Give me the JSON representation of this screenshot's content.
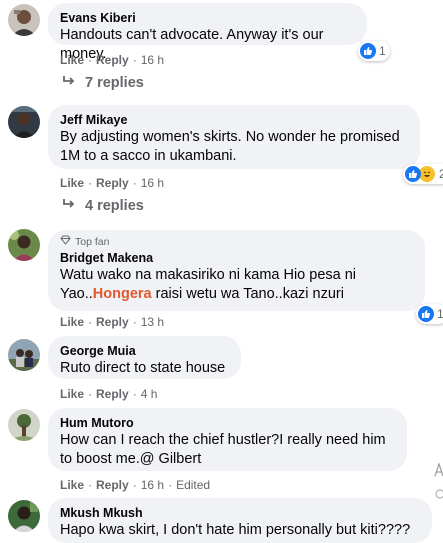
{
  "comments": [
    {
      "author": "Evans Kiberi",
      "text": "Handouts can't advocate. Anyway it's our money.",
      "like_label": "Like",
      "reply_label": "Reply",
      "time": "16 h",
      "reaction_count": "1",
      "replies_label": "7 replies"
    },
    {
      "author": "Jeff Mikaye",
      "text": "By adjusting women's skirts. No wonder he promised 1M to a sacco in ukambani.",
      "like_label": "Like",
      "reply_label": "Reply",
      "time": "16 h",
      "reaction_count": "2",
      "replies_label": "4 replies"
    },
    {
      "badge": "Top fan",
      "author": "Bridget Makena",
      "text_part1": "Watu wako na makasiriko ni kama Hio pesa ni Yao..",
      "text_highlight": "Hongera",
      "text_part2": " raisi wetu wa Tano..kazi nzuri",
      "like_label": "Like",
      "reply_label": "Reply",
      "time": "13 h",
      "reaction_count": "1"
    },
    {
      "author": "George Muia",
      "text": "Ruto direct to state house",
      "like_label": "Like",
      "reply_label": "Reply",
      "time": "4 h"
    },
    {
      "author": "Hum Mutoro",
      "text": "How can I reach the chief hustler?I really need him to boost me.@ Gilbert",
      "like_label": "Like",
      "reply_label": "Reply",
      "time": "16 h",
      "edited": "Edited"
    },
    {
      "author": "Mkush Mkush",
      "text": "Hapo kwa skirt, I don't hate him personally but kiti????"
    }
  ],
  "colors": {
    "bubble": "#f0f2f5",
    "muted": "#65676b",
    "like_blue": "#1877f2",
    "highlight": "#e4572e"
  }
}
